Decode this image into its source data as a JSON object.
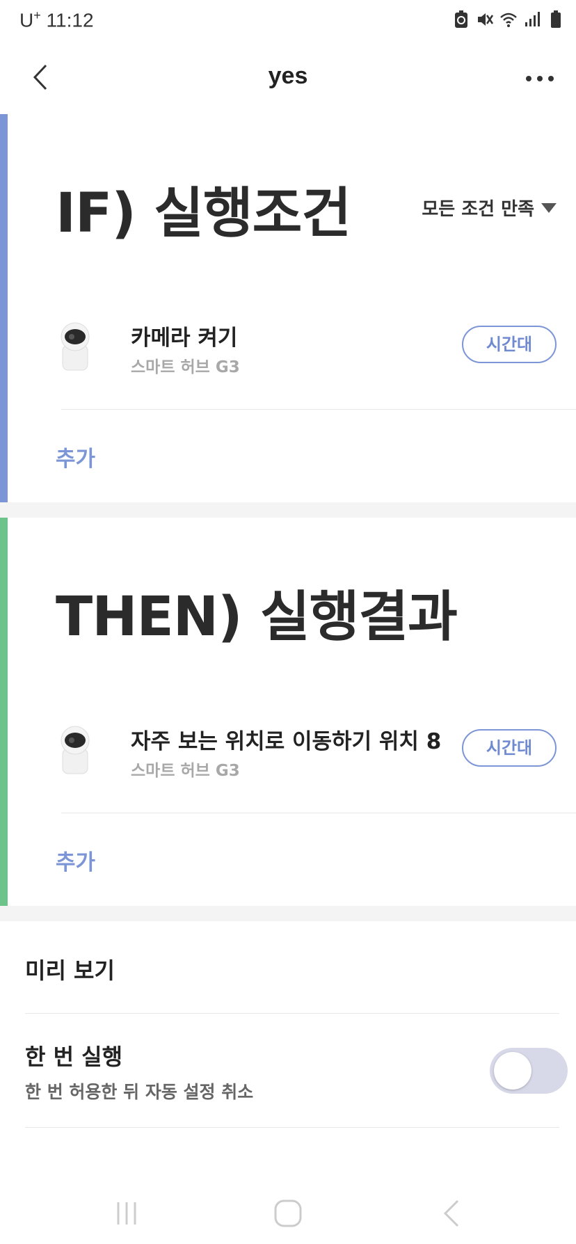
{
  "status": {
    "carrier_base": "U",
    "carrier_sup": "+",
    "time": "11:12"
  },
  "header": {
    "title": "yes"
  },
  "if_section": {
    "heading": "IF) 실행조건",
    "condition_mode": "모든 조건 만족",
    "device": {
      "name": "카메라 켜기",
      "model": "스마트 허브 G3",
      "time_button": "시간대"
    },
    "add_label": "추가",
    "accent_color": "#7b95d6"
  },
  "then_section": {
    "heading": "THEN) 실행결과",
    "device": {
      "name": "자주 보는 위치로 이동하기 위치 8",
      "model": "스마트 허브 G3",
      "time_button": "시간대"
    },
    "add_label": "추가",
    "accent_color": "#6cc48a"
  },
  "preview": {
    "label": "미리 보기"
  },
  "run_once": {
    "title": "한 번 실행",
    "subtitle": "한 번 허용한 뒤 자동 설정 취소",
    "enabled": false
  },
  "icons": [
    "battery-saver-icon",
    "mute-vibrate-icon",
    "wifi-icon",
    "signal-icon",
    "battery-icon",
    "back-arrow-icon",
    "more-dots-icon",
    "camera-device-icon",
    "dropdown-triangle-icon",
    "recents-icon",
    "home-icon",
    "nav-back-icon"
  ]
}
